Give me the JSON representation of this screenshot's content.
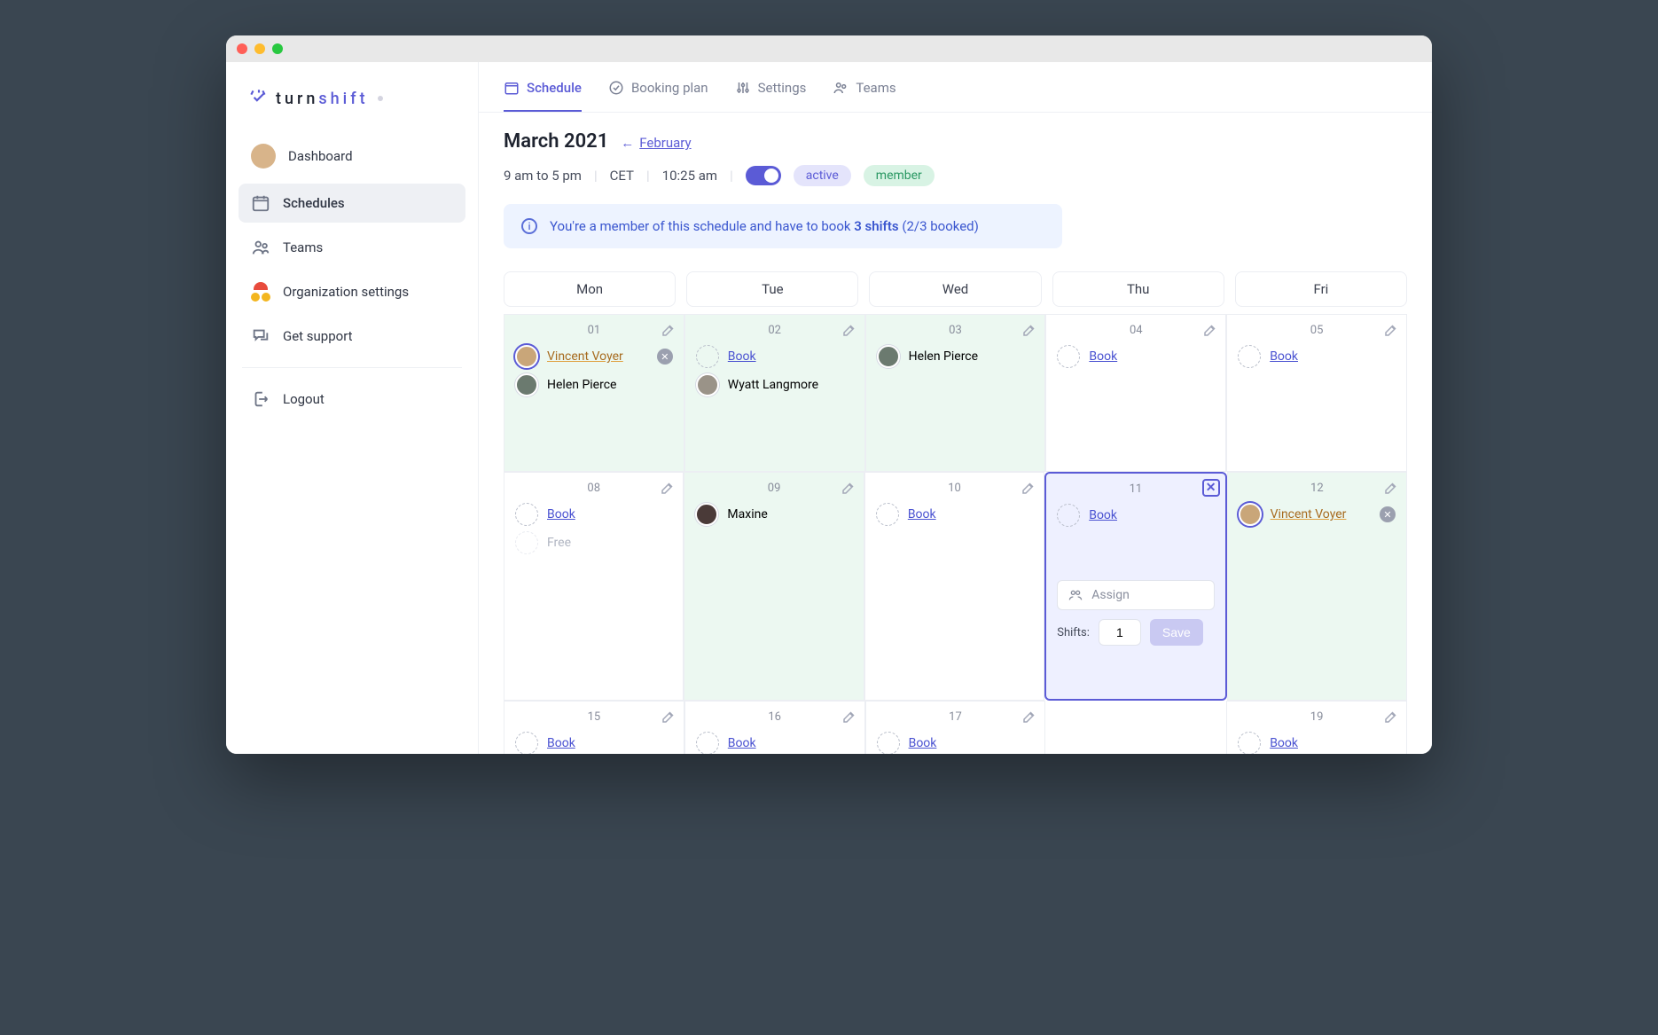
{
  "brand": {
    "name_a": "turn",
    "name_b": "shift"
  },
  "sidebar": {
    "items": [
      {
        "label": "Dashboard"
      },
      {
        "label": "Schedules"
      },
      {
        "label": "Teams"
      },
      {
        "label": "Organization settings"
      },
      {
        "label": "Get support"
      }
    ],
    "logout": "Logout"
  },
  "tabs": [
    {
      "label": "Schedule"
    },
    {
      "label": "Booking plan"
    },
    {
      "label": "Settings"
    },
    {
      "label": "Teams"
    }
  ],
  "heading": {
    "month": "March 2021",
    "prev_label": "February"
  },
  "meta": {
    "hours": "9 am to 5 pm",
    "tz": "CET",
    "time": "10:25 am",
    "active": "active",
    "member": "member"
  },
  "banner": {
    "pre": "You're a member of this schedule and have to book ",
    "bold": "3 shifts",
    "post": " (2/3 booked)"
  },
  "days": [
    "Mon",
    "Tue",
    "Wed",
    "Thu",
    "Fri"
  ],
  "cells": {
    "d01": "01",
    "d02": "02",
    "d03": "03",
    "d04": "04",
    "d05": "05",
    "d08": "08",
    "d09": "09",
    "d10": "10",
    "d11": "11",
    "d12": "12",
    "d15": "15",
    "d16": "16",
    "d17": "17",
    "d19": "19"
  },
  "labels": {
    "book": "Book",
    "free": "Free",
    "assign_placeholder": "Assign",
    "shifts": "Shifts:",
    "shifts_value": "1",
    "save": "Save"
  },
  "people": {
    "vincent": "Vincent Voyer",
    "helen": "Helen Pierce",
    "wyatt": "Wyatt Langmore",
    "maxine": "Maxine"
  }
}
